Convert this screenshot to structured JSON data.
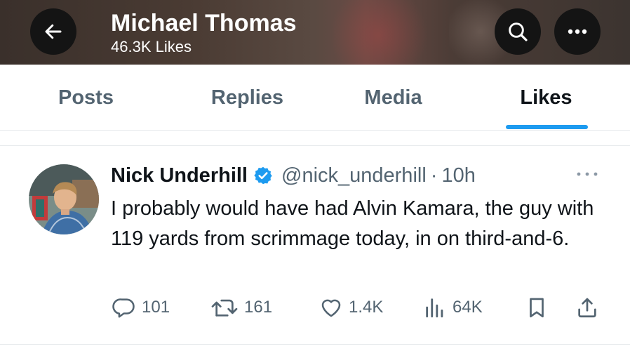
{
  "header": {
    "title": "Michael Thomas",
    "subtitle": "46.3K Likes",
    "back_icon": "arrow-left-icon",
    "search_icon": "search-icon",
    "more_icon": "more-horizontal-icon"
  },
  "tabs": [
    {
      "label": "Posts",
      "active": false
    },
    {
      "label": "Replies",
      "active": false
    },
    {
      "label": "Media",
      "active": false
    },
    {
      "label": "Likes",
      "active": true
    }
  ],
  "post": {
    "author_name": "Nick Underhill",
    "verified": true,
    "handle": "@nick_underhill",
    "separator": "·",
    "time": "10h",
    "text": "I probably would have had Alvin Kamara, the guy with 119 yards from scrimmage today, in on third-and-6.",
    "actions": {
      "replies": "101",
      "reposts": "161",
      "likes": "1.4K",
      "views": "64K"
    }
  },
  "colors": {
    "accent": "#1d9bf0",
    "muted_text": "#536471",
    "primary_text": "#0f1419",
    "divider": "#e6e9ec"
  }
}
